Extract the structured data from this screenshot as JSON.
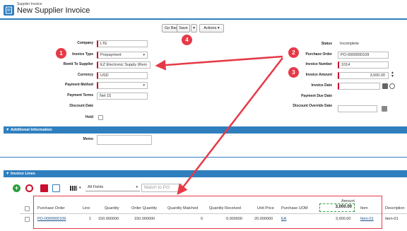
{
  "header": {
    "subtitle": "Supplier Invoice",
    "title": "New Supplier Invoice"
  },
  "toolbar": {
    "go_back": "Go Back",
    "save": "Save",
    "save_menu": "▾",
    "actions": "Actions ▾"
  },
  "form": {
    "company": {
      "label": "Company",
      "value": "LTE"
    },
    "invoice_type": {
      "label": "Invoice Type",
      "value": "Prepayment"
    },
    "remit_to": {
      "label": "Remit To Supplier",
      "value": "EZ Electronic Supply (Rem"
    },
    "currency": {
      "label": "Currency",
      "value": "USD"
    },
    "payment_method": {
      "label": "Payment Method",
      "value": ""
    },
    "payment_terms": {
      "label": "Payment Terms",
      "value": "Net 15"
    },
    "discount_date": {
      "label": "Discount Date"
    },
    "hold": {
      "label": "Hold"
    },
    "status": {
      "label": "Status",
      "value": "Incomplete"
    },
    "purchase_order": {
      "label": "Purchase Order",
      "value": "PO-0000000109"
    },
    "invoice_number": {
      "label": "Invoice Number",
      "value": "1014"
    },
    "invoice_amount": {
      "label": "Invoice Amount",
      "value": "3,000.00"
    },
    "invoice_date": {
      "label": "Invoice Date",
      "value": ""
    },
    "payment_due_date": {
      "label": "Payment Due Date"
    },
    "discount_override_date": {
      "label": "Discount Override Date",
      "value": ""
    }
  },
  "additional": {
    "title": "Additional Information",
    "memo_label": "Memo"
  },
  "lines": {
    "title": "Invoice Lines",
    "filter": "All Fields",
    "match_po": "Match to PO",
    "amount_header": "Amount",
    "amount_total": "3,000.00",
    "columns": [
      "Purchase Order",
      "Line",
      "Quantity",
      "Order Quantity",
      "Quantity Matched",
      "Quantity Received",
      "Unit Price",
      "Purchase UOM",
      "Item",
      "Description"
    ],
    "rows": [
      {
        "po": "PO-0000000109",
        "line": "1",
        "qty": "150.000000",
        "order_qty": "150.000000",
        "qty_matched": "0",
        "qty_received": "0.000000",
        "unit_price": "20.000000",
        "uom": "EA",
        "amount": "3,000.00",
        "item": "Item-01",
        "desc": "Item-01"
      }
    ]
  },
  "callouts": [
    "1",
    "2",
    "3",
    "4"
  ],
  "colors": {
    "accent": "#2f7fbf",
    "callout": "#e63946",
    "required": "#c8102e"
  }
}
